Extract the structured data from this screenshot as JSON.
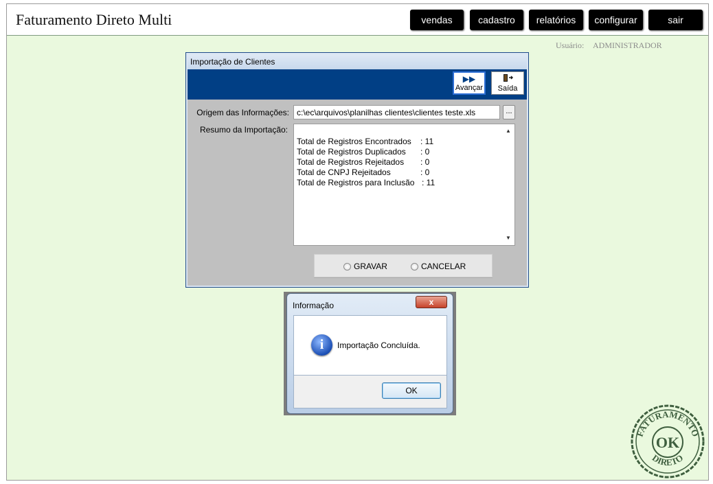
{
  "app": {
    "title": "Faturamento Direto Multi"
  },
  "nav": {
    "items": [
      {
        "label": "vendas"
      },
      {
        "label": "cadastro"
      },
      {
        "label": "relatórios"
      },
      {
        "label": "configurar"
      },
      {
        "label": "sair"
      }
    ]
  },
  "user": {
    "label": "Usuário:",
    "name": "ADMINISTRADOR"
  },
  "import_window": {
    "title": "Importação de Clientes",
    "toolbar": {
      "advance_label": "Avançar",
      "advance_icon": "fast-forward-icon",
      "exit_label": "Saída",
      "exit_icon": "door-exit-icon"
    },
    "origin_label": "Origem das Informações:",
    "origin_value": "c:\\ec\\arquivos\\planilhas clientes\\clientes teste.xls",
    "browse_label": "...",
    "summary_label": "Resumo da Importação:",
    "summary_lines": [
      {
        "key": "Total de Registros Encontrados",
        "value": ": 11"
      },
      {
        "key": "Total de Registros Duplicados",
        "value": ": 0"
      },
      {
        "key": "Total de Registros Rejeitados",
        "value": ": 0"
      },
      {
        "key": "Total de CNPJ Rejeitados",
        "value": ": 0"
      },
      {
        "key": "Total de Registros para Inclusão",
        "value": ": 11"
      }
    ],
    "actions": {
      "save_label": "GRAVAR",
      "cancel_label": "CANCELAR"
    }
  },
  "dialog": {
    "title": "Informação",
    "close_label": "x",
    "icon": "info-icon",
    "icon_glyph": "i",
    "message": "Importação Concluída.",
    "ok_label": "OK"
  },
  "stamp": {
    "top_text": "FATURAMENTO",
    "center_text": "OK",
    "bottom_text": "DIRETO",
    "color": "#3f5f3f"
  },
  "colors": {
    "background": "#eaf9de",
    "toolbar": "#013f85",
    "nav_button": "#000000"
  }
}
